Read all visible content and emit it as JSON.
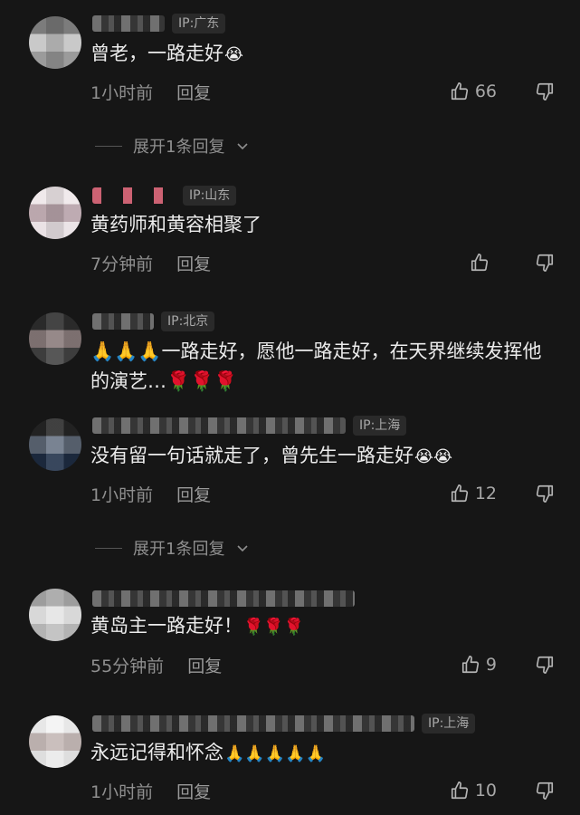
{
  "comments": [
    {
      "ip": "IP:广东",
      "text": "曾老，一路走好",
      "emoji": "😭",
      "time": "1小时前",
      "reply": "回复",
      "likes": "66"
    },
    {
      "ip": "IP:山东",
      "text": "黄药师和黄容相聚了",
      "time": "7分钟前",
      "reply": "回复",
      "likes": ""
    },
    {
      "ip": "IP:北京",
      "text": "🙏🙏🙏一路走好，愿他一路走好，在天界继续发挥他的演艺…🌹🌹🌹"
    },
    {
      "ip": "IP:上海",
      "text": "没有留一句话就走了，曾先生一路走好",
      "emoji": "😭😭",
      "time": "1小时前",
      "reply": "回复",
      "likes": "12"
    },
    {
      "ip": "",
      "text": "黄岛主一路走好！",
      "emoji": "🌹🌹🌹",
      "time": "55分钟前",
      "reply": "回复",
      "likes": "9"
    },
    {
      "ip": "IP:上海",
      "text": "永远记得和怀念",
      "emoji": "🙏🙏🙏🙏🙏",
      "time": "1小时前",
      "reply": "回复",
      "likes": "10"
    }
  ],
  "expand_replies": [
    "展开1条回复",
    "展开1条回复"
  ],
  "icons": {
    "like": "thumbs-up-icon",
    "dislike": "thumbs-down-icon",
    "chevron": "chevron-down-icon"
  },
  "colors": {
    "background": "#161616",
    "text": "#ececec",
    "muted": "#8f8f8f"
  }
}
